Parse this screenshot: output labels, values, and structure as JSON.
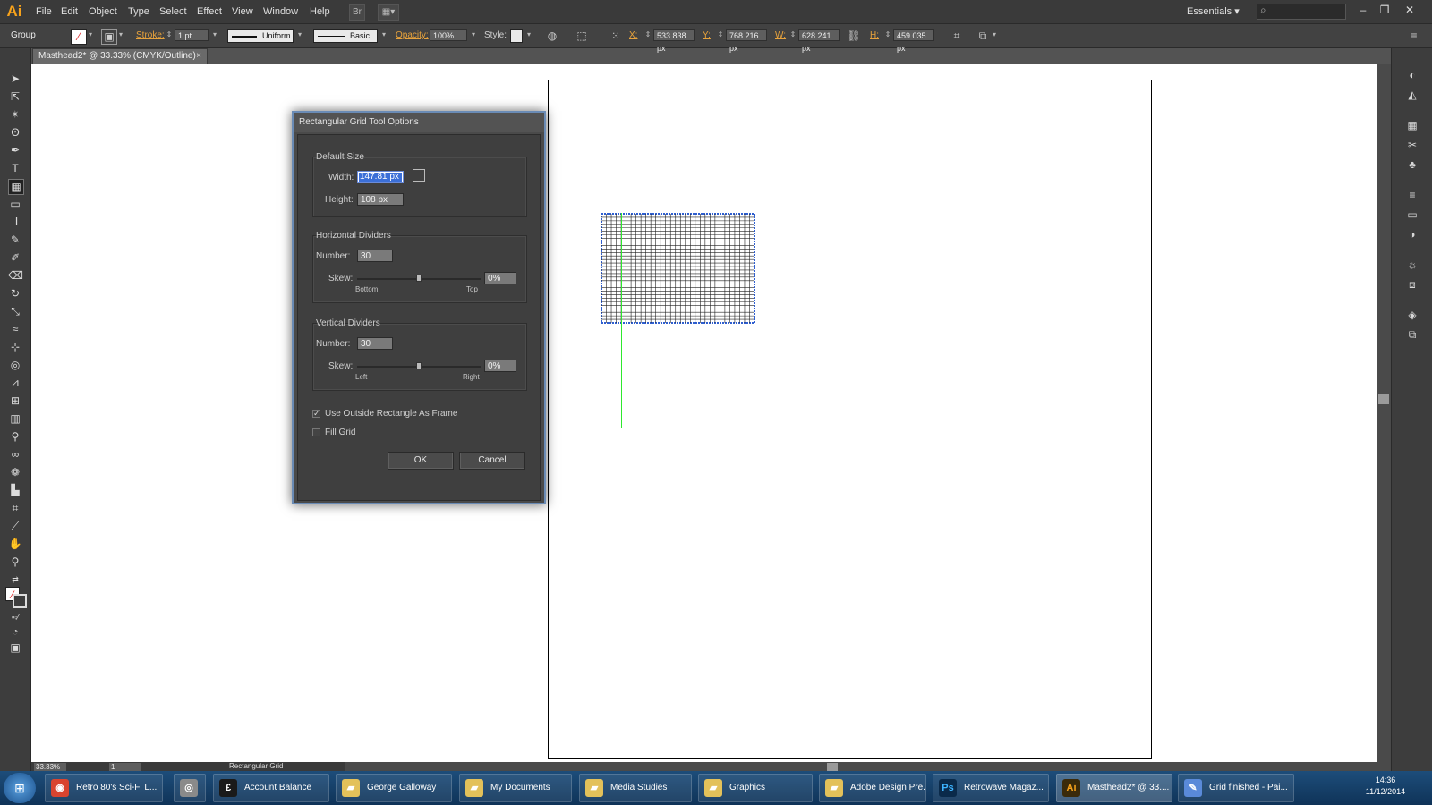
{
  "app": {
    "logo_text": "Ai",
    "workspace": "Essentials",
    "search_icon": "search-icon"
  },
  "menu": [
    "File",
    "Edit",
    "Object",
    "Type",
    "Select",
    "Effect",
    "View",
    "Window",
    "Help"
  ],
  "control_bar": {
    "selection": "Group",
    "stroke_label": "Stroke:",
    "stroke_weight": "1 pt",
    "stroke_profile": "Uniform",
    "brush": "Basic",
    "opacity_label": "Opacity:",
    "opacity": "100%",
    "style_label": "Style:",
    "x_label": "X:",
    "x_value": "533.838 px",
    "y_label": "Y:",
    "y_value": "768.216 px",
    "w_label": "W:",
    "w_value": "628.241 px",
    "h_label": "H:",
    "h_value": "459.035 px"
  },
  "document_tab": {
    "title": "Masthead2* @ 33.33% (CMYK/Outline)",
    "close": "×"
  },
  "status_bar": {
    "zoom": "33.33%",
    "page": "1",
    "tool_name": "Rectangular Grid"
  },
  "dialog": {
    "title": "Rectangular Grid Tool Options",
    "default_size": {
      "title": "Default Size",
      "width_label": "Width:",
      "width": "147.81 px",
      "height_label": "Height:",
      "height": "108 px"
    },
    "horizontal": {
      "title": "Horizontal Dividers",
      "number_label": "Number:",
      "number": "30",
      "skew_label": "Skew:",
      "skew": "0%",
      "skew_value": 0,
      "left_label": "Bottom",
      "right_label": "Top"
    },
    "vertical": {
      "title": "Vertical Dividers",
      "number_label": "Number:",
      "number": "30",
      "skew_label": "Skew:",
      "skew": "0%",
      "skew_value": 0,
      "left_label": "Left",
      "right_label": "Right"
    },
    "use_outside_rect": {
      "label": "Use Outside Rectangle As Frame",
      "checked": true
    },
    "fill_grid": {
      "label": "Fill Grid",
      "checked": false
    },
    "ok_label": "OK",
    "cancel_label": "Cancel"
  },
  "taskbar": {
    "items": [
      {
        "label": "Retro 80's Sci-Fi L...",
        "icon": "chrome-icon"
      },
      {
        "label": "",
        "icon": "media-player-icon"
      },
      {
        "label": "Account Balance",
        "icon": "pound-icon"
      },
      {
        "label": "George Galloway",
        "icon": "folder-icon"
      },
      {
        "label": "My Documents",
        "icon": "folder-icon"
      },
      {
        "label": "Media Studies",
        "icon": "folder-icon"
      },
      {
        "label": "Graphics",
        "icon": "folder-icon"
      },
      {
        "label": "Adobe Design Pre...",
        "icon": "folder-icon"
      },
      {
        "label": "Retrowave Magaz...",
        "icon": "photoshop-icon"
      },
      {
        "label": "Masthead2* @ 33....",
        "icon": "illustrator-icon"
      },
      {
        "label": "Grid finished - Pai...",
        "icon": "paint-icon"
      }
    ],
    "clock_time": "14:36",
    "clock_date": "11/12/2014"
  },
  "colors": {
    "accent": "#f7a21b",
    "selection_blue": "#3b6fd7",
    "guide_green": "#2ee82e"
  }
}
